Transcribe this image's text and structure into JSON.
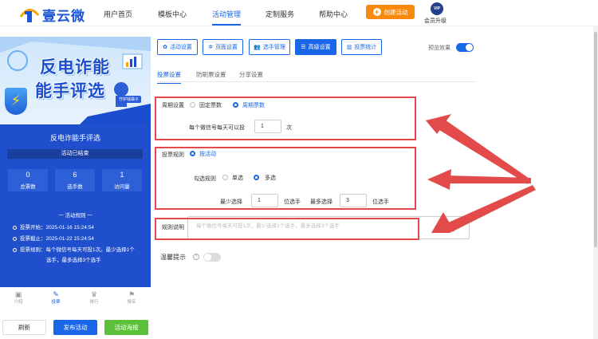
{
  "brand": {
    "name": "壹云微"
  },
  "nav": [
    "用户首页",
    "模板中心",
    "活动管理",
    "定制服务",
    "帮助中心"
  ],
  "header": {
    "create_label": "创建活动",
    "vip_badge": "VIP",
    "vip_label": "会员升级"
  },
  "preview": {
    "banner_line1": "反电诈能",
    "banner_line2": "能手评选",
    "banner_tag": "守护钱袋子",
    "title": "反电诈能手评选",
    "status": "活动已结束",
    "stats": [
      {
        "value": "0",
        "label": "总票数"
      },
      {
        "value": "6",
        "label": "选手数"
      },
      {
        "value": "1",
        "label": "访问量"
      }
    ],
    "info_title": "一 活动规则 一",
    "info_lines": [
      "投票开始：2025-01-16 15:24:54",
      "投票截止：2025-01-22 15:24:54",
      "投票规则：每个微信号每天可投1次。最少选择1个",
      "选手，最多选择3个选手"
    ],
    "tabs": [
      "介绍",
      "投票",
      "排行",
      "报名"
    ],
    "buttons": {
      "refresh": "刷新",
      "publish": "发布活动",
      "promote": "活动海报"
    }
  },
  "toolbar": {
    "items": [
      "活动设置",
      "页面设置",
      "选手管理",
      "高级设置",
      "投票统计"
    ],
    "active_index": 3,
    "preview_label": "预览效果",
    "preview_on": true
  },
  "subtabs": [
    "投票设置",
    "防刷票设置",
    "分享设置"
  ],
  "settings": {
    "cycle_label": "周期设置",
    "cycle_options": [
      "固定票数",
      "周期票数"
    ],
    "cycle_selected": 1,
    "daily_prefix": "每个微信号每天可以投",
    "daily_value": "1",
    "daily_suffix": "次",
    "rule_label": "投票规则",
    "rule_option": "按活动",
    "check_label": "勾选规则",
    "check_options": [
      "单选",
      "多选"
    ],
    "check_selected": 1,
    "min_label": "最少选择",
    "min_value": "1",
    "min_unit": "位选手",
    "max_label": "最多选择",
    "max_value": "3",
    "max_unit": "位选手",
    "desc_label": "规则说明",
    "desc_placeholder": "每个微信号每天可投1次，最少选择1个选手，最多选择3个选手",
    "tip_label": "温馨提示",
    "tip_on": false
  },
  "colors": {
    "primary": "#1a66e8",
    "accent": "#f7890c",
    "highlight": "#e34a4a",
    "promote": "#5cc13a"
  }
}
